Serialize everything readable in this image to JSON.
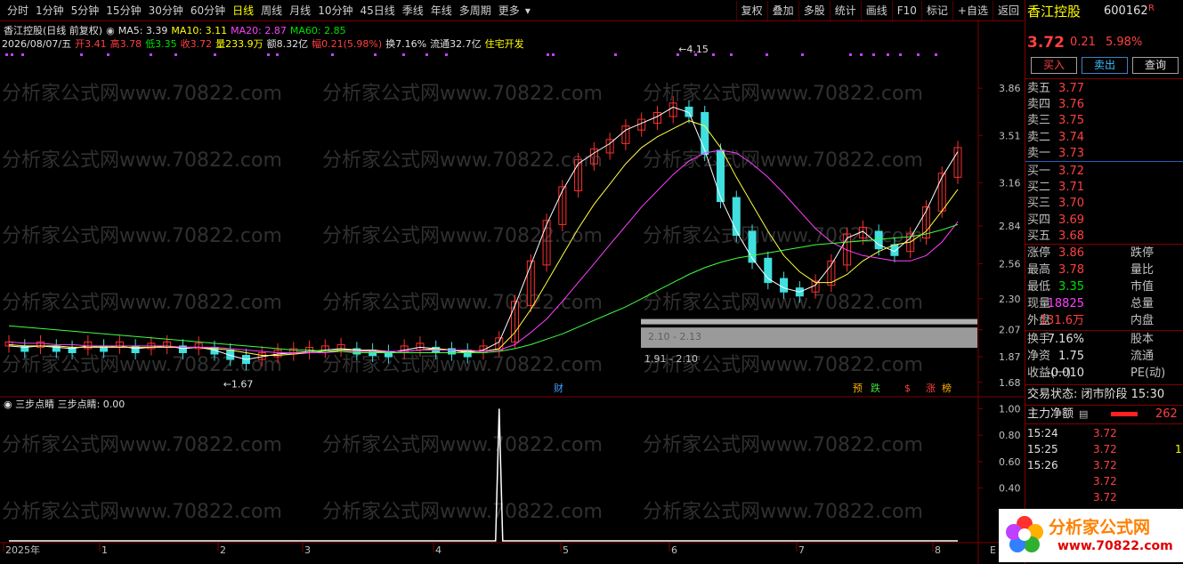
{
  "toolbar": {
    "periods": [
      "分时",
      "1分钟",
      "5分钟",
      "15分钟",
      "30分钟",
      "60分钟",
      "日线",
      "周线",
      "月线",
      "10分钟",
      "45日线",
      "季线",
      "年线",
      "多周期",
      "更多"
    ],
    "active_period": "日线",
    "tools": [
      "复权",
      "叠加",
      "多股",
      "统计",
      "画线",
      "F10",
      "标记",
      "+自选",
      "返回"
    ]
  },
  "stock_header": {
    "title": "香江控股(日线 前复权)",
    "ma5": "MA5: 3.39",
    "ma10": "MA10: 3.11",
    "ma20": "MA20: 2.87",
    "ma60": "MA60: 2.85",
    "date": "2026/08/07/五",
    "open": "开3.41",
    "high": "高3.78",
    "low": "低3.35",
    "close": "收3.72",
    "volume": "量233.9万",
    "amount": "额8.32亿",
    "change": "幅0.21(5.98%)",
    "turnover": "换7.16%",
    "float_cap": "流通32.7亿",
    "sector": "住宅开发"
  },
  "watermark": "分析家公式网www.70822.com",
  "colors": {
    "up": "#ff3030",
    "down": "#40e0e0",
    "ma5": "#ffffff",
    "ma10": "#ffff40",
    "ma20": "#ff40ff",
    "ma60": "#40ff40",
    "border": "#800000"
  },
  "chart_data": [
    {
      "type": "line",
      "title": "香江控股(日线 前复权)",
      "x": [
        "2025年",
        "1",
        "2",
        "3",
        "4",
        "5",
        "6",
        "7",
        "8"
      ],
      "y_ticks": [
        1.68,
        1.87,
        2.07,
        2.3,
        2.56,
        2.84,
        3.16,
        3.51,
        3.86
      ],
      "ylim": [
        1.6,
        4.25
      ],
      "annotations": {
        "peak": "4.15",
        "low": "1.67",
        "zone1": "2.10 - 2.13",
        "zone2": "1.91 - 2.10"
      },
      "markers": [
        "财",
        "预",
        "跌",
        "$",
        "涨",
        "榜"
      ],
      "series": [
        {
          "name": "MA5",
          "values": [
            1.95,
            1.94,
            1.95,
            1.94,
            1.93,
            1.95,
            1.94,
            1.95,
            1.93,
            1.94,
            1.95,
            1.93,
            1.94,
            1.92,
            1.88,
            1.85,
            1.87,
            1.89,
            1.9,
            1.91,
            1.92,
            1.93,
            1.92,
            1.91,
            1.9,
            1.92,
            1.94,
            1.93,
            1.92,
            1.9,
            1.92,
            1.98,
            2.25,
            2.55,
            2.85,
            3.1,
            3.3,
            3.38,
            3.45,
            3.55,
            3.6,
            3.65,
            3.72,
            3.68,
            3.4,
            3.05,
            2.8,
            2.6,
            2.45,
            2.38,
            2.35,
            2.4,
            2.55,
            2.75,
            2.8,
            2.7,
            2.65,
            2.75,
            2.95,
            3.2,
            3.39
          ]
        },
        {
          "name": "MA10",
          "values": [
            1.96,
            1.95,
            1.95,
            1.95,
            1.94,
            1.94,
            1.94,
            1.94,
            1.94,
            1.94,
            1.94,
            1.94,
            1.94,
            1.93,
            1.92,
            1.9,
            1.88,
            1.88,
            1.89,
            1.9,
            1.91,
            1.92,
            1.92,
            1.92,
            1.91,
            1.91,
            1.92,
            1.93,
            1.92,
            1.91,
            1.91,
            1.93,
            2.05,
            2.22,
            2.42,
            2.62,
            2.82,
            3.0,
            3.15,
            3.3,
            3.42,
            3.5,
            3.56,
            3.62,
            3.58,
            3.42,
            3.2,
            3.0,
            2.8,
            2.62,
            2.5,
            2.42,
            2.42,
            2.48,
            2.58,
            2.65,
            2.7,
            2.72,
            2.8,
            2.95,
            3.11
          ]
        },
        {
          "name": "MA20",
          "values": [
            1.98,
            1.97,
            1.97,
            1.96,
            1.96,
            1.95,
            1.95,
            1.95,
            1.95,
            1.95,
            1.95,
            1.94,
            1.94,
            1.94,
            1.93,
            1.92,
            1.91,
            1.9,
            1.9,
            1.9,
            1.9,
            1.91,
            1.91,
            1.91,
            1.91,
            1.91,
            1.92,
            1.92,
            1.92,
            1.92,
            1.91,
            1.92,
            1.96,
            2.05,
            2.15,
            2.28,
            2.42,
            2.56,
            2.7,
            2.84,
            2.98,
            3.1,
            3.22,
            3.32,
            3.38,
            3.4,
            3.38,
            3.3,
            3.2,
            3.08,
            2.95,
            2.82,
            2.72,
            2.66,
            2.62,
            2.6,
            2.58,
            2.58,
            2.62,
            2.72,
            2.87
          ]
        },
        {
          "name": "MA60",
          "values": [
            2.1,
            2.09,
            2.08,
            2.07,
            2.06,
            2.05,
            2.04,
            2.03,
            2.02,
            2.01,
            2.0,
            1.99,
            1.98,
            1.97,
            1.96,
            1.95,
            1.94,
            1.93,
            1.92,
            1.92,
            1.91,
            1.91,
            1.9,
            1.9,
            1.9,
            1.9,
            1.9,
            1.9,
            1.9,
            1.9,
            1.9,
            1.91,
            1.93,
            1.96,
            2.0,
            2.04,
            2.09,
            2.14,
            2.19,
            2.24,
            2.3,
            2.36,
            2.42,
            2.48,
            2.53,
            2.57,
            2.6,
            2.62,
            2.64,
            2.66,
            2.68,
            2.7,
            2.71,
            2.72,
            2.73,
            2.74,
            2.75,
            2.76,
            2.78,
            2.81,
            2.85
          ]
        }
      ]
    },
    {
      "type": "line",
      "title": "三步点睛",
      "label": "三步点睛: 0.00",
      "y_ticks": [
        0.4,
        0.6,
        0.8,
        1.0
      ],
      "ylim": [
        0.0,
        1.05
      ],
      "series": [
        {
          "name": "三步点睛",
          "values": [
            0,
            0,
            0,
            0,
            0,
            0,
            0,
            0,
            0,
            0,
            0,
            0,
            0,
            0,
            0,
            0,
            0,
            0,
            0,
            0,
            0,
            0,
            0,
            0,
            0,
            0,
            0,
            0,
            0,
            0,
            0,
            1.0,
            0,
            0,
            0,
            0,
            0,
            0,
            0,
            0,
            0,
            0,
            0,
            0,
            0,
            0,
            0,
            0,
            0,
            0,
            0,
            0,
            0,
            0,
            0,
            0,
            0,
            0,
            0,
            0,
            0
          ]
        }
      ]
    }
  ],
  "quote": {
    "name": "香江控股",
    "code": "600162",
    "r_badge": "R",
    "price": "3.72",
    "change": "0.21",
    "pct": "5.98%",
    "buy_btn": "买入",
    "sell_btn": "卖出",
    "query_btn": "查询",
    "asks": [
      {
        "label": "卖五",
        "price": "3.77"
      },
      {
        "label": "卖四",
        "price": "3.76"
      },
      {
        "label": "卖三",
        "price": "3.75"
      },
      {
        "label": "卖二",
        "price": "3.74"
      },
      {
        "label": "卖一",
        "price": "3.73"
      }
    ],
    "bids": [
      {
        "label": "买一",
        "price": "3.72"
      },
      {
        "label": "买二",
        "price": "3.71"
      },
      {
        "label": "买三",
        "price": "3.70"
      },
      {
        "label": "买四",
        "price": "3.69"
      },
      {
        "label": "买五",
        "price": "3.68"
      }
    ],
    "stats": [
      {
        "l": "涨停",
        "v": "3.86",
        "c": "red",
        "r": "跌停"
      },
      {
        "l": "最高",
        "v": "3.78",
        "c": "red",
        "r": "量比"
      },
      {
        "l": "最低",
        "v": "3.35",
        "c": "green",
        "r": "市值"
      },
      {
        "l": "现量",
        "v": "18825",
        "c": "mag",
        "r": "总量"
      },
      {
        "l": "外盘",
        "v": "131.6万",
        "c": "red",
        "r": "内盘"
      }
    ],
    "stats2": [
      {
        "l": "换手",
        "v": "7.16%",
        "c": "white",
        "r": "股本"
      },
      {
        "l": "净资",
        "v": "1.75",
        "c": "white",
        "r": "流通"
      },
      {
        "l": "收益(一)",
        "v": "-0.010",
        "c": "white",
        "r": "PE(动)"
      }
    ],
    "trade_status": "交易状态: 闭市阶段 15:30",
    "main_net_label": "主力净额",
    "main_net_value": "262",
    "ticks": [
      {
        "t": "15:24",
        "p": "3.72",
        "v": ""
      },
      {
        "t": "15:25",
        "p": "3.72",
        "v": "1"
      },
      {
        "t": "15:26",
        "p": "3.72",
        "v": ""
      },
      {
        "t": "",
        "p": "3.72",
        "v": ""
      },
      {
        "t": "",
        "p": "3.72",
        "v": ""
      }
    ],
    "logo_text": "分析家公式网",
    "logo_url": "www.70822.com"
  }
}
